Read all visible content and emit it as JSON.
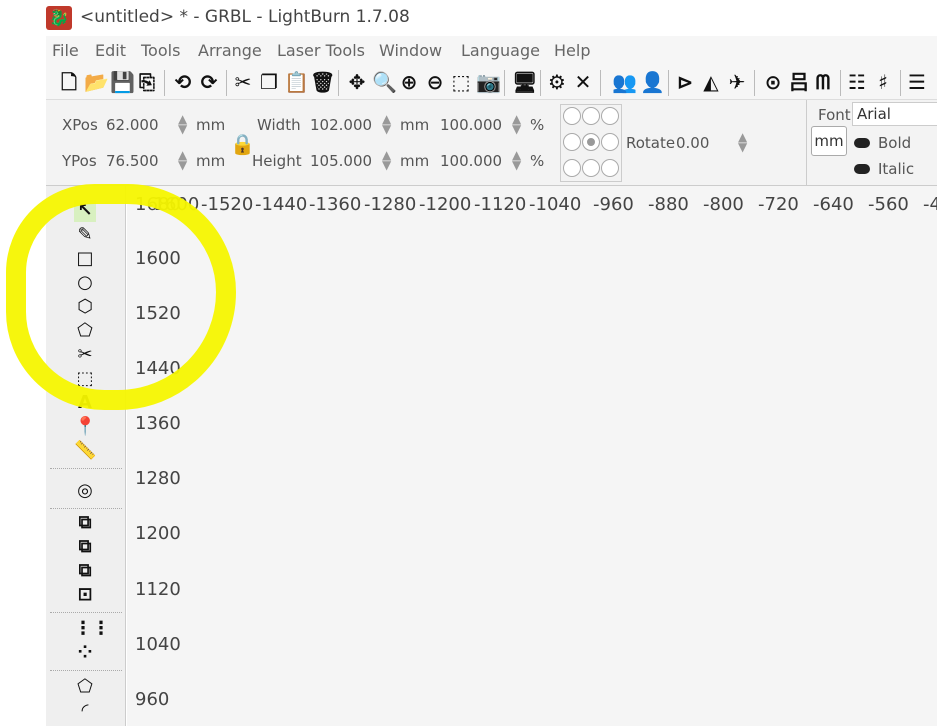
{
  "window": {
    "title": "<untitled> * - GRBL - LightBurn 1.7.08",
    "app_icon": "lightburn-logo"
  },
  "menu": [
    "File",
    "Edit",
    "Tools",
    "Arrange",
    "Laser Tools",
    "Window",
    "Language",
    "Help"
  ],
  "toolbar_icons": [
    "new-file",
    "open-folder",
    "save",
    "import",
    "rotate-ccw",
    "rotate-cw",
    "cut",
    "copy",
    "paste",
    "delete",
    "move",
    "zoom-selection",
    "zoom-in",
    "zoom-out",
    "frame",
    "camera",
    "monitor",
    "settings",
    "tools",
    "users",
    "user",
    "mirror-h",
    "mirror-v",
    "measure",
    "target",
    "group",
    "align",
    "distribute",
    "more"
  ],
  "properties": {
    "xpos_label": "XPos",
    "xpos_value": "62.000",
    "ypos_label": "YPos",
    "ypos_value": "76.500",
    "width_label": "Width",
    "width_value": "102.000",
    "height_label": "Height",
    "height_value": "105.000",
    "unit": "mm",
    "scale_w": "100.000",
    "scale_h": "100.000",
    "percent": "%",
    "rotate_label": "Rotate",
    "rotate_value": "0.00",
    "unit_button": "mm",
    "font_label": "Font",
    "font_value": "Arial",
    "bold_label": "Bold",
    "italic_label": "Italic"
  },
  "tools": [
    "select",
    "draw-lines",
    "rectangle",
    "ellipse",
    "polygon",
    "edit-nodes",
    "trim",
    "tabs",
    "text",
    "position-laser",
    "measure"
  ],
  "tools_lower": [
    "offset",
    "boolean-union",
    "boolean-subtract",
    "boolean-intersect",
    "weld",
    "grid-array",
    "circular-array",
    "convert-to-path",
    "corner-radius"
  ],
  "ruler_x": [
    "-1600",
    "-1520",
    "-1440",
    "-1360",
    "-1280",
    "-1200",
    "-1120",
    "-1040",
    "-960",
    "-880",
    "-800",
    "-720",
    "-640",
    "-560",
    "-4"
  ],
  "ruler_y": [
    "1680",
    "1600",
    "1520",
    "1440",
    "1360",
    "1280",
    "1200",
    "1120",
    "1040",
    "960"
  ],
  "colors": {
    "highlight": "#f5f500",
    "logo": "#c0392b"
  }
}
